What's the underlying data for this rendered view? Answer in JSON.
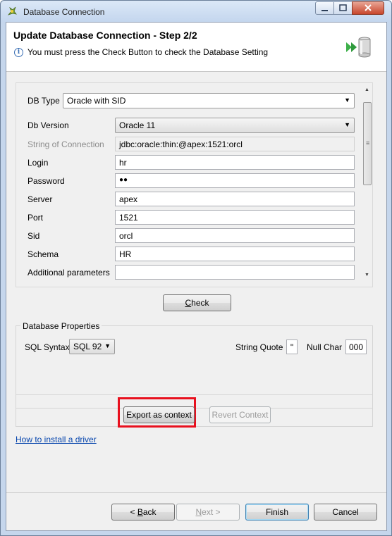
{
  "window": {
    "title": "Database Connection"
  },
  "header": {
    "title": "Update Database Connection - Step 2/2",
    "message": "You must press the Check Button to check the Database Setting"
  },
  "form": {
    "db_type_label": "DB Type",
    "db_type_value": "Oracle with SID",
    "db_version_label": "Db Version",
    "db_version_value": "Oracle 11",
    "conn_string_label": "String of Connection",
    "conn_string_value": "jdbc:oracle:thin:@apex:1521:orcl",
    "login_label": "Login",
    "login_value": "hr",
    "password_label": "Password",
    "password_value": "●●",
    "server_label": "Server",
    "server_value": "apex",
    "port_label": "Port",
    "port_value": "1521",
    "sid_label": "Sid",
    "sid_value": "orcl",
    "schema_label": "Schema",
    "schema_value": "HR",
    "additional_label": "Additional parameters",
    "additional_value": ""
  },
  "check_button": {
    "label_pre": "",
    "label_ul": "C",
    "label_post": "heck"
  },
  "db_properties": {
    "title": "Database Properties",
    "sql_syntax_label": "SQL Syntax",
    "sql_syntax_value": "SQL 92",
    "string_quote_label": "String Quote",
    "string_quote_value": "\"",
    "null_char_label": "Null Char",
    "null_char_value": "000"
  },
  "context": {
    "export_label": "Export as context",
    "revert_label": "Revert Context"
  },
  "install_link": "How to install a driver",
  "footer": {
    "back_pre": "< ",
    "back_ul": "B",
    "back_post": "ack",
    "next_pre": "",
    "next_ul": "N",
    "next_post": "ext >",
    "finish_label": "Finish",
    "cancel_label": "Cancel"
  },
  "icons": {
    "app": "talend-app-icon",
    "info": "info-icon",
    "database": "database-arrow-icon"
  },
  "colors": {
    "highlight": "#e8101e",
    "link": "#0645ad",
    "info": "#3a6fb4"
  }
}
